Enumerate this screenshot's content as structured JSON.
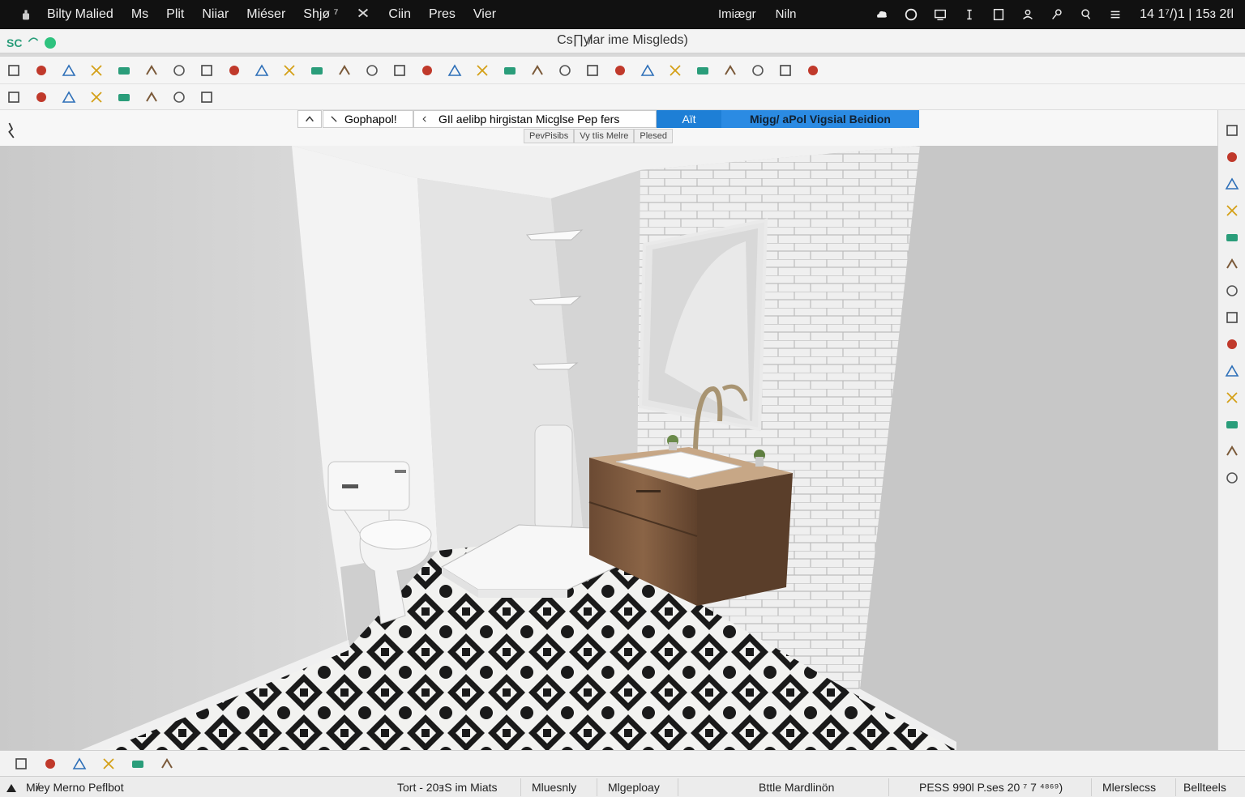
{
  "menubar": {
    "items": [
      "Bilty Malied",
      "Ms",
      "Plit",
      "Niiar",
      "Miéser",
      "Shjø ⁷",
      "Ciin",
      "Pres",
      "Vier"
    ],
    "center_items": [
      "Imiægr",
      "Niln"
    ],
    "clock": "14 1⁷/)1 | 15ɜ 2ℓl"
  },
  "titlebar": {
    "logo": "SC",
    "title": "Cs∏y̸lar ime Misgleds)"
  },
  "toolbar1_icons": [
    "sidebar-toggle-icon",
    "layout-icon",
    "material-ball-icon",
    "image-icon",
    "color-swatch-icon",
    "frame-icon",
    "ruler-icon",
    "document-icon",
    "grid-icon",
    "globe-icon",
    "plant-icon",
    "house-icon",
    "select-icon",
    "box-icon",
    "tag-icon",
    "paint-roller-icon",
    "brush-icon",
    "cube-icon",
    "bucket-icon",
    "mirror-icon",
    "stairs-icon",
    "funnel-icon",
    "wand-icon",
    "close-x-icon",
    "triangle-icon",
    "circle-icon",
    "square-icon",
    "pause-icon",
    "infinity-icon",
    "panel-icon"
  ],
  "toolbar2_icons": [
    "eraser-icon",
    "pencil-icon",
    "tag-outline-icon",
    "table-icon",
    "grid-edit-icon",
    "figure-icon",
    "line-icon",
    "sub-square-icon"
  ],
  "scene": {
    "option_a": "Gophapol!",
    "option_b": "GIl aelibp hirgistan Micglse Pep fers",
    "option_c": "Aït",
    "option_d": "Migg/ aPol Vigsial Beidion",
    "subtabs": [
      "PevPisibs",
      "Vy tIis Melre",
      "Plesed"
    ]
  },
  "right_panel_icons": [
    "undo-icon",
    "eraser-icon",
    "magic-brush-icon",
    "window-icon",
    "diamond-icon",
    "lasso-icon",
    "calculator-icon",
    "target-icon",
    "cross-tool-icon",
    "layers-icon",
    "settings-sliders-icon",
    "image-swap-icon",
    "code-icon",
    "minus-panel-icon"
  ],
  "bottom_tools": [
    "ss-icon",
    "display-icon",
    "folder-icon",
    "chart-icon",
    "monitor-icon",
    "search-icon"
  ],
  "statusbar": {
    "left": "Mi̸ey Merno Peflbot",
    "center1": "Tort - 20ⱻS im Miats",
    "center2": "Mluesnly",
    "center3": "Mlgeploay",
    "center4": "Bttle Mardlinön",
    "right1": "PESS 990l P.ses 20 ⁷ 7 ⁴⁸⁶⁹)",
    "right2": "Mlerslecss",
    "right3": "Bellteels"
  }
}
